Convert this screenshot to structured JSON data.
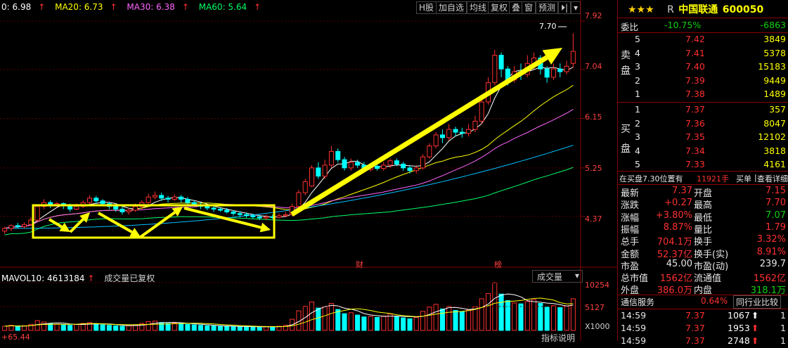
{
  "ma": [
    {
      "label": "0: 6.98",
      "color": "#ffffff"
    },
    {
      "label": "MA20: 6.73",
      "color": "#ffff00"
    },
    {
      "label": "MA30: 6.38",
      "color": "#ff66ff"
    },
    {
      "label": "MA60: 5.64",
      "color": "#00ff66"
    }
  ],
  "toolbar": [
    "H股",
    "加自选",
    "均线",
    "复权",
    "叠",
    "窗",
    "预测"
  ],
  "price_axis": [
    "7.92",
    "7.04",
    "6.15",
    "5.25",
    "4.37"
  ],
  "high_marker": "7.70",
  "markers": [
    {
      "text": "财"
    },
    {
      "text": "榜"
    }
  ],
  "volume": {
    "indicator": "MAVOL10: 4613184",
    "note": "成交量已复权",
    "selector": "成交量",
    "axis": [
      "10254",
      "5127",
      "X1000"
    ],
    "footer_left": "+65.44",
    "footer_right": "指标说明"
  },
  "stock": {
    "stars": "★★★",
    "flag": "R",
    "name": "中国联通",
    "code": "600050"
  },
  "order_book": {
    "weibi_label": "委比",
    "weibi": "-10.75%",
    "weicha": "-6863",
    "sell_label": [
      "卖",
      "盘"
    ],
    "buy_label": [
      "买",
      "盘"
    ],
    "sell": [
      {
        "level": "5",
        "price": "7.42",
        "vol": "3849"
      },
      {
        "level": "4",
        "price": "7.41",
        "vol": "5378"
      },
      {
        "level": "3",
        "price": "7.40",
        "vol": "15183"
      },
      {
        "level": "2",
        "price": "7.39",
        "vol": "9449"
      },
      {
        "level": "1",
        "price": "7.38",
        "vol": "1489"
      }
    ],
    "buy": [
      {
        "level": "1",
        "price": "7.37",
        "vol": "357"
      },
      {
        "level": "2",
        "price": "7.36",
        "vol": "8047"
      },
      {
        "level": "3",
        "price": "7.35",
        "vol": "12102"
      },
      {
        "level": "4",
        "price": "7.34",
        "vol": "3818"
      },
      {
        "level": "5",
        "price": "7.33",
        "vol": "4161"
      }
    ]
  },
  "buy_info": {
    "text": "在买盘7.30位置有",
    "qty": "11921手",
    "link1": "买单",
    "link2": "查看详细"
  },
  "stats": [
    {
      "l": "最新",
      "lv": "7.37",
      "lc": "#ff3030",
      "r": "开盘",
      "rv": "7.15",
      "rc": "#ff3030"
    },
    {
      "l": "涨跌",
      "lv": "+0.27",
      "lc": "#ff3030",
      "r": "最高",
      "rv": "7.70",
      "rc": "#ff3030"
    },
    {
      "l": "涨幅",
      "lv": "+3.80%",
      "lc": "#ff3030",
      "r": "最低",
      "rv": "7.07",
      "rc": "#10d010"
    },
    {
      "l": "振幅",
      "lv": "8.87%",
      "lc": "#ff3030",
      "r": "量比",
      "rv": "1.79",
      "rc": "#ff3030"
    },
    {
      "l": "总手",
      "lv": "704.1万",
      "lc": "#ff3030",
      "r": "换手",
      "rv": "3.32%",
      "rc": "#ff3030"
    },
    {
      "l": "金额",
      "lv": "52.37亿",
      "lc": "#ff3030",
      "r": "换手(实)",
      "rv": "8.91%",
      "rc": "#ff3030"
    },
    {
      "l": "市盈",
      "lv": "45.00",
      "lc": "#e6e6e6",
      "r": "市盈(动)",
      "rv": "239.7",
      "rc": "#e6e6e6"
    },
    {
      "l": "总市值",
      "lv": "1562亿",
      "lc": "#ff3030",
      "r": "流通值",
      "rv": "1562亿",
      "rc": "#ff3030"
    },
    {
      "l": "外盘",
      "lv": "386.0万",
      "lc": "#ff3030",
      "r": "内盘",
      "rv": "318.1万",
      "rc": "#10d010"
    }
  ],
  "industry": {
    "name": "通信服务",
    "pct": "0.64%",
    "compare": "同行业比较"
  },
  "ticks": [
    {
      "time": "14:59",
      "price": "7.37",
      "vol": "1067",
      "arrow": "up-white",
      "n": "1"
    },
    {
      "time": "14:59",
      "price": "7.37",
      "vol": "1953",
      "arrow": "up-red",
      "n": "1"
    },
    {
      "time": "14:59",
      "price": "7.37",
      "vol": "2748",
      "arrow": "up-red",
      "n": "1"
    }
  ],
  "chart_data": {
    "type": "candlestick",
    "title": "中国联通 600050",
    "y_ticks": [
      7.92,
      7.04,
      6.15,
      5.25,
      4.37
    ],
    "ylim": [
      3.7,
      8.1
    ],
    "candles": [
      [
        4.1,
        4.15,
        4.05,
        4.18
      ],
      [
        4.15,
        4.2,
        4.1,
        4.22
      ],
      [
        4.2,
        4.18,
        4.15,
        4.25
      ],
      [
        4.18,
        4.22,
        4.15,
        4.26
      ],
      [
        4.22,
        4.3,
        4.2,
        4.35
      ],
      [
        4.3,
        4.55,
        4.28,
        4.58
      ],
      [
        4.55,
        4.62,
        4.5,
        4.68
      ],
      [
        4.62,
        4.58,
        4.52,
        4.66
      ],
      [
        4.58,
        4.6,
        4.54,
        4.63
      ],
      [
        4.6,
        4.56,
        4.5,
        4.62
      ],
      [
        4.56,
        4.5,
        4.45,
        4.6
      ],
      [
        4.5,
        4.55,
        4.48,
        4.6
      ],
      [
        4.55,
        4.62,
        4.52,
        4.66
      ],
      [
        4.62,
        4.7,
        4.6,
        4.75
      ],
      [
        4.7,
        4.65,
        4.6,
        4.74
      ],
      [
        4.65,
        4.6,
        4.55,
        4.68
      ],
      [
        4.6,
        4.55,
        4.5,
        4.63
      ],
      [
        4.55,
        4.5,
        4.45,
        4.58
      ],
      [
        4.5,
        4.45,
        4.4,
        4.55
      ],
      [
        4.45,
        4.48,
        4.4,
        4.52
      ],
      [
        4.48,
        4.55,
        4.45,
        4.6
      ],
      [
        4.55,
        4.62,
        4.5,
        4.66
      ],
      [
        4.62,
        4.72,
        4.6,
        4.78
      ],
      [
        4.72,
        4.75,
        4.68,
        4.82
      ],
      [
        4.75,
        4.7,
        4.65,
        4.8
      ],
      [
        4.7,
        4.68,
        4.62,
        4.74
      ],
      [
        4.68,
        4.72,
        4.65,
        4.77
      ],
      [
        4.72,
        4.68,
        4.62,
        4.76
      ],
      [
        4.68,
        4.62,
        4.58,
        4.72
      ],
      [
        4.62,
        4.58,
        4.55,
        4.66
      ],
      [
        4.58,
        4.55,
        4.5,
        4.62
      ],
      [
        4.55,
        4.52,
        4.48,
        4.58
      ],
      [
        4.52,
        4.5,
        4.45,
        4.55
      ],
      [
        4.5,
        4.48,
        4.45,
        4.53
      ],
      [
        4.48,
        4.45,
        4.42,
        4.52
      ],
      [
        4.45,
        4.42,
        4.38,
        4.48
      ],
      [
        4.42,
        4.4,
        4.35,
        4.46
      ],
      [
        4.4,
        4.38,
        4.34,
        4.44
      ],
      [
        4.38,
        4.36,
        4.32,
        4.42
      ],
      [
        4.36,
        4.34,
        4.3,
        4.4
      ],
      [
        4.34,
        4.36,
        4.3,
        4.4
      ],
      [
        4.36,
        4.35,
        4.32,
        4.4
      ],
      [
        4.35,
        4.38,
        4.33,
        4.42
      ],
      [
        4.38,
        4.4,
        4.35,
        4.45
      ],
      [
        4.4,
        4.55,
        4.38,
        4.6
      ],
      [
        4.55,
        4.8,
        4.52,
        4.85
      ],
      [
        4.8,
        5.0,
        4.75,
        5.05
      ],
      [
        4.92,
        5.25,
        4.9,
        5.3
      ],
      [
        5.25,
        5.1,
        5.05,
        5.35
      ],
      [
        5.1,
        5.3,
        5.05,
        5.4
      ],
      [
        5.3,
        5.55,
        5.25,
        5.65
      ],
      [
        5.55,
        5.4,
        5.35,
        5.6
      ],
      [
        5.4,
        5.25,
        5.2,
        5.45
      ],
      [
        5.25,
        5.35,
        5.2,
        5.42
      ],
      [
        5.35,
        5.3,
        5.25,
        5.4
      ],
      [
        5.3,
        5.22,
        5.18,
        5.36
      ],
      [
        5.22,
        5.28,
        5.18,
        5.32
      ],
      [
        5.28,
        5.24,
        5.2,
        5.33
      ],
      [
        5.24,
        5.3,
        5.2,
        5.36
      ],
      [
        5.3,
        5.38,
        5.25,
        5.42
      ],
      [
        5.38,
        5.32,
        5.28,
        5.42
      ],
      [
        5.32,
        5.25,
        5.2,
        5.36
      ],
      [
        5.25,
        5.2,
        5.15,
        5.3
      ],
      [
        5.2,
        5.25,
        5.15,
        5.3
      ],
      [
        5.25,
        5.45,
        5.22,
        5.5
      ],
      [
        5.45,
        5.65,
        5.42,
        5.7
      ],
      [
        5.65,
        5.85,
        5.6,
        5.9
      ],
      [
        5.85,
        5.8,
        5.7,
        5.95
      ],
      [
        5.8,
        5.95,
        5.75,
        6.05
      ],
      [
        5.95,
        5.9,
        5.82,
        6.0
      ],
      [
        5.9,
        5.88,
        5.8,
        5.98
      ],
      [
        5.88,
        5.95,
        5.82,
        6.05
      ],
      [
        5.95,
        6.1,
        5.9,
        6.2
      ],
      [
        6.1,
        6.45,
        6.05,
        6.55
      ],
      [
        6.45,
        6.8,
        6.4,
        6.9
      ],
      [
        6.8,
        7.3,
        6.75,
        7.4
      ],
      [
        7.3,
        7.05,
        6.9,
        7.35
      ],
      [
        7.05,
        6.85,
        6.75,
        7.1
      ],
      [
        6.85,
        7.0,
        6.8,
        7.1
      ],
      [
        7.0,
        6.95,
        6.85,
        7.15
      ],
      [
        6.95,
        7.15,
        6.9,
        7.3
      ],
      [
        7.15,
        7.25,
        7.05,
        7.35
      ],
      [
        7.25,
        7.05,
        6.95,
        7.3
      ],
      [
        7.05,
        6.9,
        6.8,
        7.1
      ],
      [
        6.9,
        7.05,
        6.85,
        7.15
      ],
      [
        7.05,
        7.0,
        6.9,
        7.15
      ],
      [
        7.0,
        7.1,
        6.95,
        7.2
      ],
      [
        7.15,
        7.37,
        7.07,
        7.7
      ]
    ],
    "volume": {
      "ylim": [
        0,
        10254
      ],
      "values": [
        900,
        1100,
        800,
        1000,
        1300,
        2100,
        1800,
        1500,
        1300,
        1200,
        1100,
        1300,
        1500,
        1700,
        1400,
        1200,
        1100,
        1000,
        900,
        1000,
        1200,
        1500,
        1900,
        2000,
        1700,
        1500,
        1600,
        1500,
        1300,
        1200,
        1100,
        1000,
        950,
        900,
        880,
        850,
        800,
        780,
        760,
        740,
        800,
        820,
        900,
        1100,
        2400,
        4200,
        5200,
        6100,
        4800,
        5100,
        5800,
        4500,
        3600,
        3800,
        3300,
        2900,
        3000,
        2800,
        3100,
        3500,
        3000,
        2700,
        2500,
        2800,
        4100,
        5000,
        5600,
        4600,
        5200,
        4300,
        4000,
        4400,
        5100,
        6800,
        7900,
        10254,
        7800,
        6400,
        5900,
        5700,
        6200,
        6600,
        5800,
        5000,
        5300,
        4900,
        5200,
        6800
      ]
    }
  }
}
